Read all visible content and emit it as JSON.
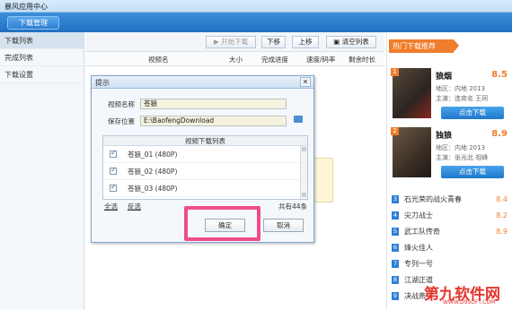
{
  "window": {
    "title": "暴风应用中心"
  },
  "tabs": {
    "active": "下载管理"
  },
  "sidebar": {
    "items": [
      {
        "label": "下载列表"
      },
      {
        "label": "完成列表"
      },
      {
        "label": "下载设置"
      }
    ]
  },
  "toolbar": {
    "start": "▶ 开始下载",
    "down": "下移",
    "up": "上移",
    "clear": "清空列表"
  },
  "table": {
    "headers": [
      "视频名",
      "大小",
      "完成进度",
      "速度/码率",
      "剩余时长"
    ]
  },
  "dialog": {
    "title": "提示",
    "video_name_label": "视频名称",
    "video_name_value": "苍狼",
    "save_label": "保存位置",
    "save_value": "E:\\BaofengDownload",
    "list_title": "视频下载列表",
    "rows": [
      {
        "text": "苍狼_01 (480P)"
      },
      {
        "text": "苍狼_02 (480P)"
      },
      {
        "text": "苍狼_03 (480P)"
      }
    ],
    "select_all": "全选",
    "invert": "反选",
    "count": "共有44条",
    "ok": "确定",
    "cancel": "取消"
  },
  "right": {
    "title": "热门下载推荐",
    "movies": [
      {
        "rank": "1",
        "title": "狼烟",
        "score": "8.5",
        "region": "地区：内地 2013",
        "cast": "主演：连奕名  王珂",
        "button": "点击下载"
      },
      {
        "rank": "2",
        "title": "独狼",
        "score": "8.9",
        "region": "地区：内地 2013",
        "cast": "主演：张光北  祖峰",
        "button": "点击下载"
      }
    ],
    "rank_list": [
      {
        "rank": "3",
        "name": "石光荣的战火青春",
        "score": "8.4"
      },
      {
        "rank": "4",
        "name": "尖刀战士",
        "score": "8.2"
      },
      {
        "rank": "5",
        "name": "武工队传奇",
        "score": "8.9"
      },
      {
        "rank": "6",
        "name": "烽火佳人",
        "score": ""
      },
      {
        "rank": "7",
        "name": "专列一号",
        "score": ""
      },
      {
        "rank": "8",
        "name": "江湖正道",
        "score": ""
      },
      {
        "rank": "9",
        "name": "决战燕子",
        "score": ""
      }
    ]
  },
  "watermark": {
    "text": "第九软件网",
    "sub": "WWW.D9SOFT.COM"
  }
}
